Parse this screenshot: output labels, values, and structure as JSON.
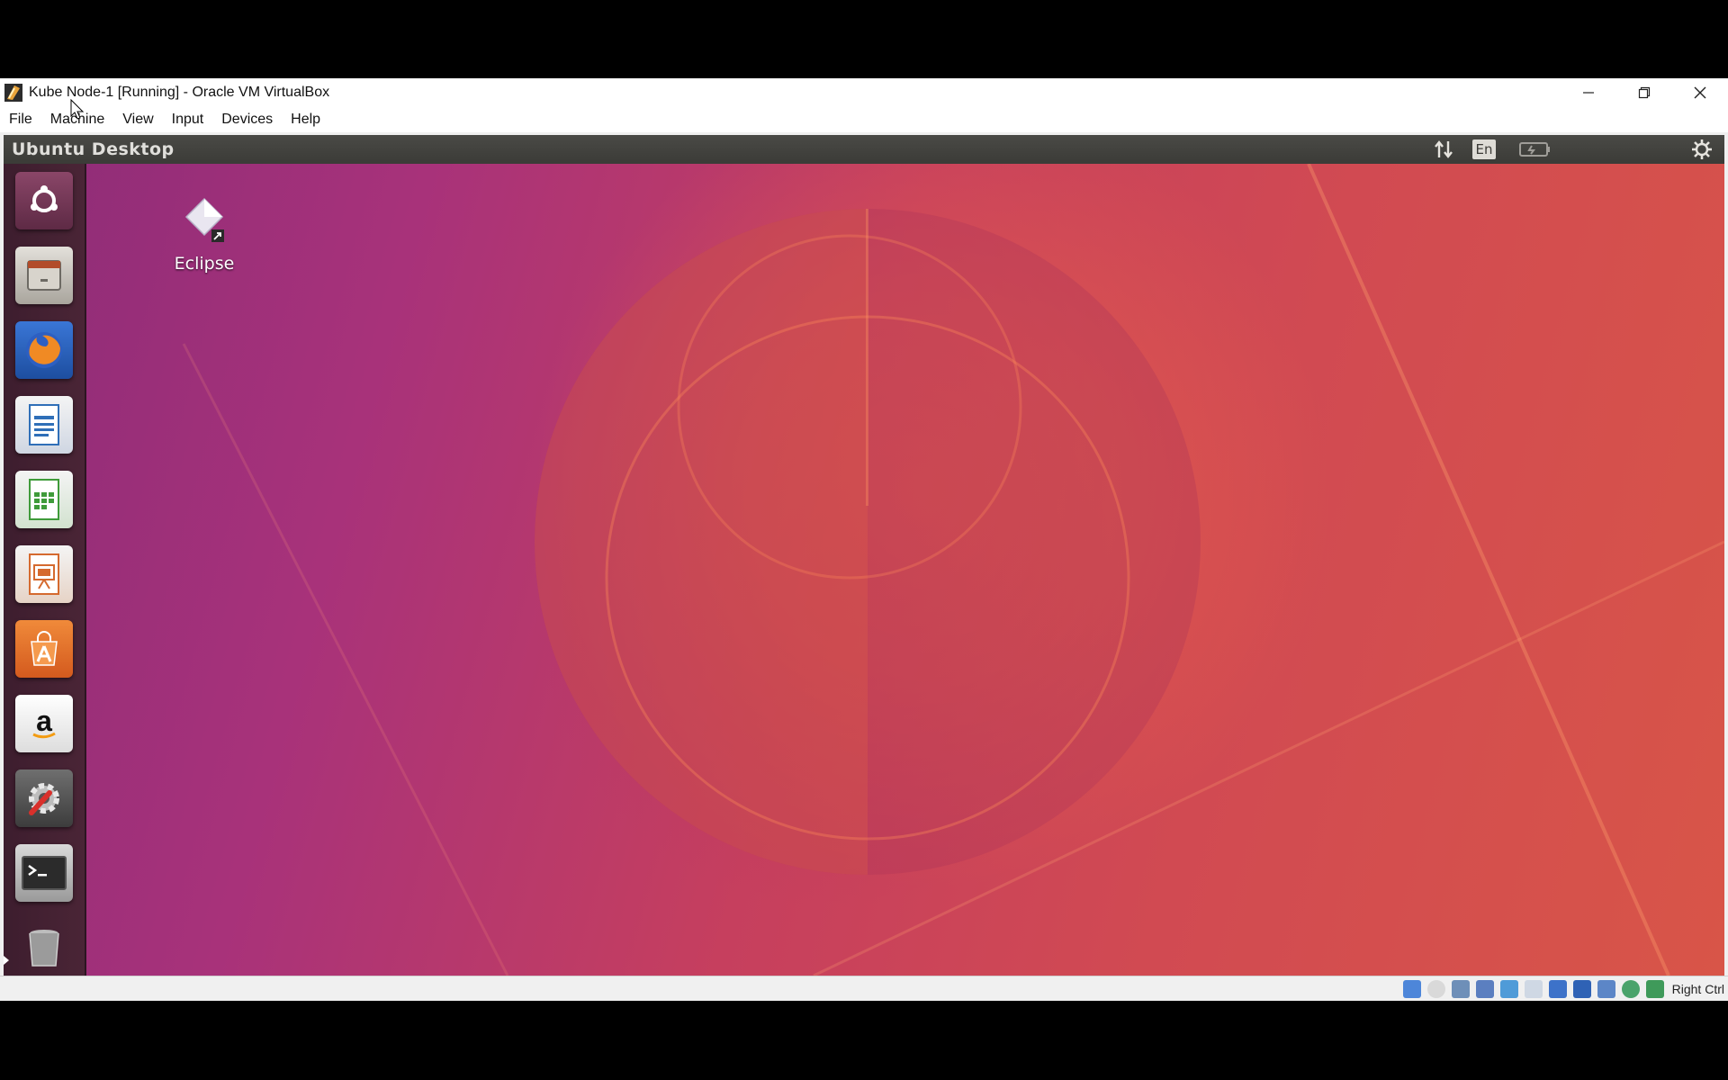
{
  "window": {
    "title": "Kube Node-1 [Running] - Oracle VM VirtualBox",
    "controls": {
      "minimize": "minimize-icon",
      "restore": "restore-icon",
      "close": "close-icon"
    }
  },
  "menu": {
    "items": [
      "File",
      "Machine",
      "View",
      "Input",
      "Devices",
      "Help"
    ]
  },
  "vm": {
    "panel": {
      "title": "Ubuntu Desktop",
      "language": "En",
      "indicators": [
        "network-arrows-icon",
        "language-indicator",
        "battery-icon",
        "settings-gear-icon"
      ]
    },
    "launcher": {
      "items": [
        {
          "name": "ubuntu-dash",
          "icon": "ubuntu-logo-icon",
          "color": "#7a3b5e"
        },
        {
          "name": "files",
          "icon": "file-cabinet-icon",
          "color": "#c9c6bf"
        },
        {
          "name": "firefox",
          "icon": "firefox-icon",
          "color": "#2a64c4"
        },
        {
          "name": "writer",
          "icon": "libreoffice-writer-icon",
          "color": "#2f6fb8"
        },
        {
          "name": "calc",
          "icon": "libreoffice-calc-icon",
          "color": "#3f9b3a"
        },
        {
          "name": "impress",
          "icon": "libreoffice-impress-icon",
          "color": "#d56a2f"
        },
        {
          "name": "software",
          "icon": "software-center-icon",
          "color": "#e8772e"
        },
        {
          "name": "amazon",
          "icon": "amazon-icon",
          "color": "#f2f2f2"
        },
        {
          "name": "settings",
          "icon": "system-settings-icon",
          "color": "#5c5c5c"
        },
        {
          "name": "terminal",
          "icon": "terminal-icon",
          "color": "#2b2b2b"
        },
        {
          "name": "trash",
          "icon": "trash-icon",
          "color": "#8a8a8a"
        }
      ]
    },
    "desktop_icons": [
      {
        "label": "Eclipse",
        "icon": "eclipse-shortcut-icon"
      }
    ]
  },
  "statusbar": {
    "host_key": "Right Ctrl",
    "icons": [
      "hard-disk-icon",
      "optical-drive-icon",
      "audio-icon",
      "network-icon",
      "usb-icon",
      "shared-folders-icon",
      "display-icon",
      "video-capture-icon",
      "mouse-integration-icon",
      "guest-additions-icon",
      "cpu-icon"
    ]
  },
  "colors": {
    "accent_orange": "#e95420",
    "ubuntu_aubergine": "#77216f",
    "panel_bg": "#3c3b37"
  }
}
